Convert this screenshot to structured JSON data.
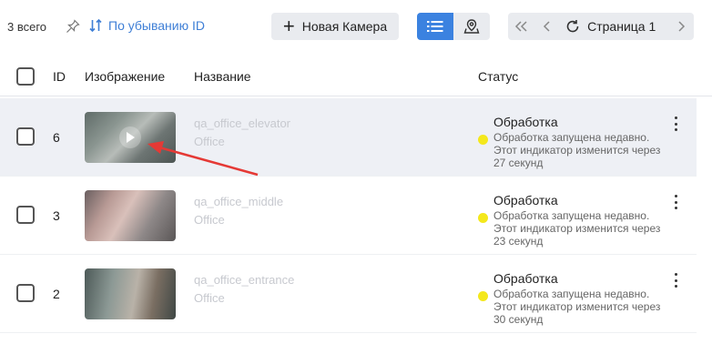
{
  "toolbar": {
    "total": "3 всего",
    "sort_label": "По убыванию ID",
    "new_camera": "Новая Камера",
    "page_label": "Страница 1"
  },
  "table": {
    "columns": [
      "ID",
      "Изображение",
      "Название",
      "Статус"
    ],
    "rows": [
      {
        "id": "6",
        "name": "qa_office_elevator",
        "location": "Office",
        "status_title": "Обработка",
        "status_desc": "Обработка запущена недавно. Этот индикатор изменится через 27 секунд",
        "selected": true
      },
      {
        "id": "3",
        "name": "qa_office_middle",
        "location": "Office",
        "status_title": "Обработка",
        "status_desc": "Обработка запущена недавно. Этот индикатор изменится через 23 секунд",
        "selected": false
      },
      {
        "id": "2",
        "name": "qa_office_entrance",
        "location": "Office",
        "status_title": "Обработка",
        "status_desc": "Обработка запущена недавно. Этот индикатор изменится через 30 секунд",
        "selected": false
      }
    ]
  },
  "colors": {
    "accent": "#3b82e0",
    "status_dot": "#f4e81c",
    "annotation_arrow": "#e53935"
  },
  "icons": {
    "pin": "pin-icon",
    "sort": "sort-arrows-icon",
    "plus": "plus-icon",
    "list_view": "list-view-icon",
    "map_view": "map-marker-icon",
    "first": "double-chevron-left-icon",
    "prev": "chevron-left-icon",
    "refresh": "refresh-icon",
    "next": "chevron-right-icon",
    "play": "play-icon",
    "more": "kebab-menu-icon"
  }
}
